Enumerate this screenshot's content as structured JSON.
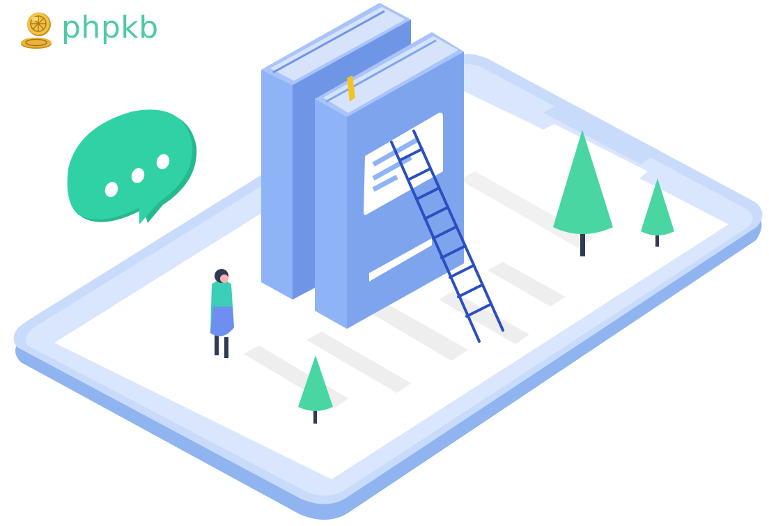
{
  "brand": {
    "name": "phpkb",
    "logo_icon": "gold-coin-icon",
    "color": "#4fc9a7"
  },
  "illustration": {
    "icons": [
      "smartphone-icon",
      "book-icon",
      "ladder-icon",
      "chat-bubble-icon",
      "tree-icon",
      "person-icon"
    ],
    "colors": {
      "phone_frame": "#c9dbfb",
      "phone_edge": "#8fb4ef",
      "book_front": "#7ea4ee",
      "book_side": "#8fb3f7",
      "ladder": "#2b4fc0",
      "tree": "#49d6a3",
      "chat_bubble": "#2fd1a5",
      "bookmark": "#f2c41e"
    }
  }
}
